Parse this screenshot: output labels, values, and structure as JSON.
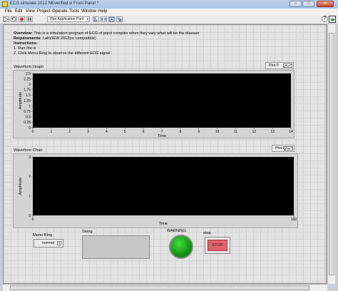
{
  "window": {
    "title": "ECG simulate 2012 NEverified.vi Front Panel *",
    "minimize_glyph": "–",
    "maximize_glyph": "□",
    "close_glyph": "✕"
  },
  "menu": [
    "File",
    "Edit",
    "View",
    "Project",
    "Operate",
    "Tools",
    "Window",
    "Help"
  ],
  "toolbar": {
    "font": "15pt Application Font",
    "dropdown_glyph": "▾",
    "help_glyph": "?"
  },
  "instructions": {
    "overview_label": "Overview:",
    "overview_text": " This is a simulation program of ECG of pqrst complex when they vary what will be the disease",
    "requirements_label": "Requirements:",
    "requirements_text": " LabVIEW 2012(or compatible)",
    "instructions_label": "Instructions:",
    "steps": [
      "1. Run the vi",
      "2. Click Menu Ring to observe the different ECG signal"
    ]
  },
  "waveform_graph": {
    "label": "Waveform Graph",
    "legend": "Plot 0",
    "chart_data": {
      "type": "line",
      "title": "Waveform Graph",
      "xlabel": "Time",
      "ylabel": "Amplitude",
      "xlim": [
        0,
        14
      ],
      "ylim": [
        0,
        2.5
      ],
      "x_ticks": [
        0,
        1,
        2,
        3,
        4,
        5,
        6,
        7,
        8,
        9,
        10,
        11,
        12,
        13,
        14
      ],
      "y_ticks": [
        0,
        0.25,
        0.5,
        0.75,
        1,
        1.25,
        1.5,
        1.75,
        2,
        2.25,
        2.5
      ],
      "series": [
        {
          "name": "Plot 0",
          "values": []
        }
      ],
      "grid": false,
      "legend_position": "top-right"
    }
  },
  "waveform_chart": {
    "label": "Waveform Chart",
    "legend": "Plot 0",
    "chart_data": {
      "type": "line",
      "title": "Waveform Chart",
      "xlabel": "Time",
      "ylabel": "Amplitude",
      "xlim": [
        0,
        100
      ],
      "ylim": [
        0,
        3
      ],
      "x_ticks": [
        0,
        100
      ],
      "y_ticks": [
        0,
        1,
        2,
        3
      ],
      "series": [
        {
          "name": "Plot 0",
          "values": []
        }
      ],
      "grid": false,
      "legend_position": "top-right"
    }
  },
  "controls": {
    "menu_ring_label": "Menu Ring",
    "menu_ring_value": "normal",
    "string_label": "String",
    "string_value": "",
    "warning_label": "WARNING",
    "warning_color": "#14a614",
    "stop_label": "stop",
    "stop_button_text": "STOP",
    "stop_color": "#e3616b"
  }
}
